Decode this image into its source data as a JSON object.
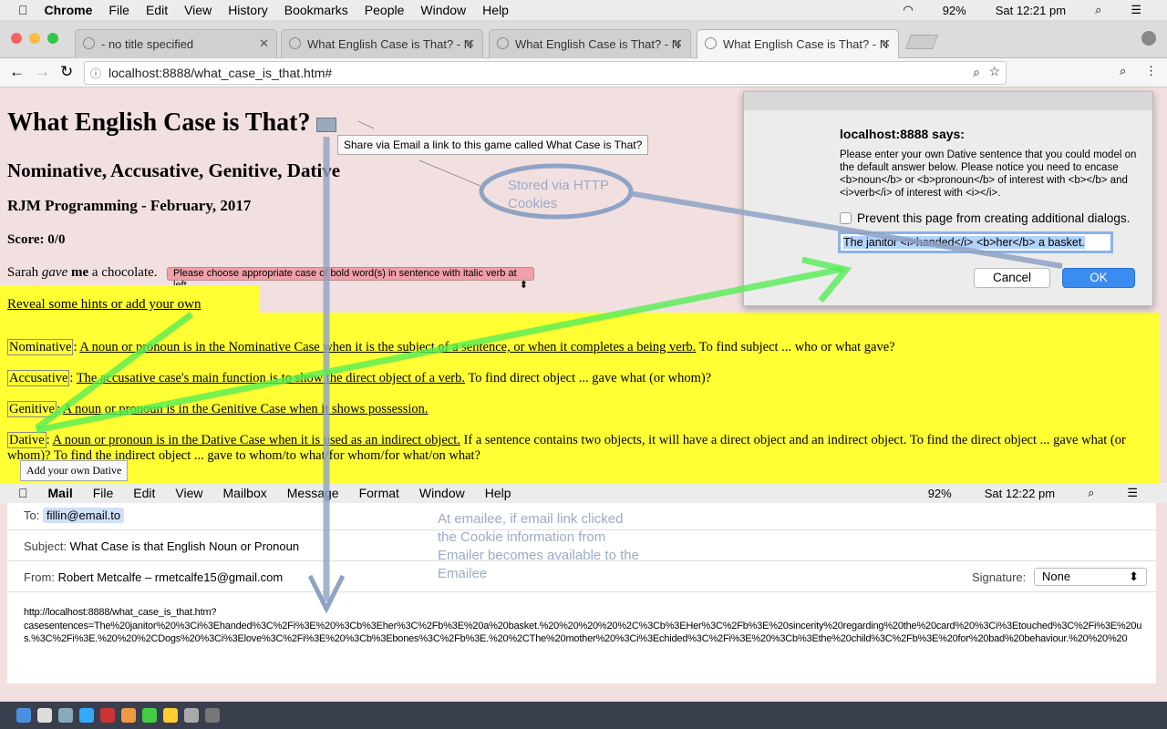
{
  "menubar": {
    "apple": "",
    "app": "Chrome",
    "items": [
      "File",
      "Edit",
      "View",
      "History",
      "Bookmarks",
      "People",
      "Window",
      "Help"
    ],
    "battery": "92%",
    "clock": "Sat 12:21 pm"
  },
  "tabs": [
    {
      "title": "- no title specified"
    },
    {
      "title": "What English Case is That? - N"
    },
    {
      "title": "What English Case is That? - N"
    },
    {
      "title": "What English Case is That? - N",
      "active": true
    }
  ],
  "address": {
    "url": "localhost:8888/what_case_is_that.htm#"
  },
  "page": {
    "title": "What English Case is That?",
    "email_tooltip": "Share via Email a link to this game called What Case is That?",
    "subtitle": "Nominative, Accusative, Genitive, Dative",
    "byline": "RJM Programming - February, 2017",
    "score": "Score: 0/0",
    "sentence": {
      "pre": "Sarah ",
      "verb": "gave",
      "mid": " ",
      "noun": "me",
      "post": " a chocolate."
    },
    "select": "Please choose appropriate case of bold word(s) in sentence with italic verb at left",
    "hints_link": "Reveal some hints or add your own sentence?",
    "cases": [
      {
        "name": "Nominative",
        "link": "A noun or pronoun is in the Nominative Case when it is the subject of a sentence, or when it completes a being verb.",
        "extra": " To find subject ... who or what gave?"
      },
      {
        "name": "Accusative",
        "link": "The accusative case's main function is to show the direct object of a verb.",
        "extra": " To find direct object ... gave what (or whom)?"
      },
      {
        "name": "Genitive",
        "link": "A noun or pronoun is in the Genitive Case when it shows possession.",
        "extra": ""
      },
      {
        "name": "Dative",
        "link": "A noun or pronoun is in the Dative Case when it is used as an indirect object.",
        "extra": " If a sentence contains two objects, it will have a direct object and an indirect object. To find the direct object ... gave what (or whom)? To find the indirect object ... gave to whom/to what/for whom/for what/on what?"
      }
    ],
    "dative_tooltip": "Add your own Dative"
  },
  "dialog": {
    "title": "localhost:8888 says:",
    "message": "Please enter your own Dative sentence that you could model on the default answer below.  Please notice you need to encase <b>noun</b> or <b>pronoun</b> of interest with <b></b> and <i>verb</i> of interest with <i></i>.",
    "checkbox": "Prevent this page from creating additional dialogs.",
    "input": "The janitor <i>handed</i> <b>her</b> a basket.",
    "cancel": "Cancel",
    "ok": "OK"
  },
  "annotations": {
    "cookies": "Stored via HTTP Cookies",
    "emailee": "At emailee, if email link clicked the Cookie information from Emailer becomes available to the Emailee"
  },
  "mail": {
    "app": "Mail",
    "items": [
      "File",
      "Edit",
      "View",
      "Mailbox",
      "Message",
      "Format",
      "Window",
      "Help"
    ],
    "battery": "92%",
    "clock": "Sat 12:22 pm",
    "to_label": "To:",
    "to": "fillin@email.to",
    "subject_label": "Subject:",
    "subject": "What Case is that English Noun or Pronoun",
    "from_label": "From:",
    "from": "Robert Metcalfe – rmetcalfe15@gmail.com",
    "signature_label": "Signature:",
    "signature": "None",
    "body": "http://localhost:8888/what_case_is_that.htm?\ncasesentences=The%20janitor%20%3Ci%3Ehanded%3C%2Fi%3E%20%3Cb%3Eher%3C%2Fb%3E%20a%20basket.%20%20%20%20%2C%3Cb%3EHer%3C%2Fb%3E%20sincerity%20regarding%20the%20card%20%3Ci%3Etouched%3C%2Fi%3E%20us.%3C%2Fi%3E.%20%20%2CDogs%20%3Ci%3Elove%3C%2Fi%3E%20%3Cb%3Ebones%3C%2Fb%3E.%20%2CThe%20mother%20%3Ci%3Echided%3C%2Fi%3E%20%3Cb%3Ethe%20child%3C%2Fb%3E%20for%20bad%20behaviour.%20%20%20"
  },
  "colors": {
    "page_bg": "#f2e0e0",
    "highlight": "#ffff33",
    "ok_button": "#3b8cf0",
    "annotation": "#8fa3c4",
    "green_arrow": "#55ee55"
  }
}
